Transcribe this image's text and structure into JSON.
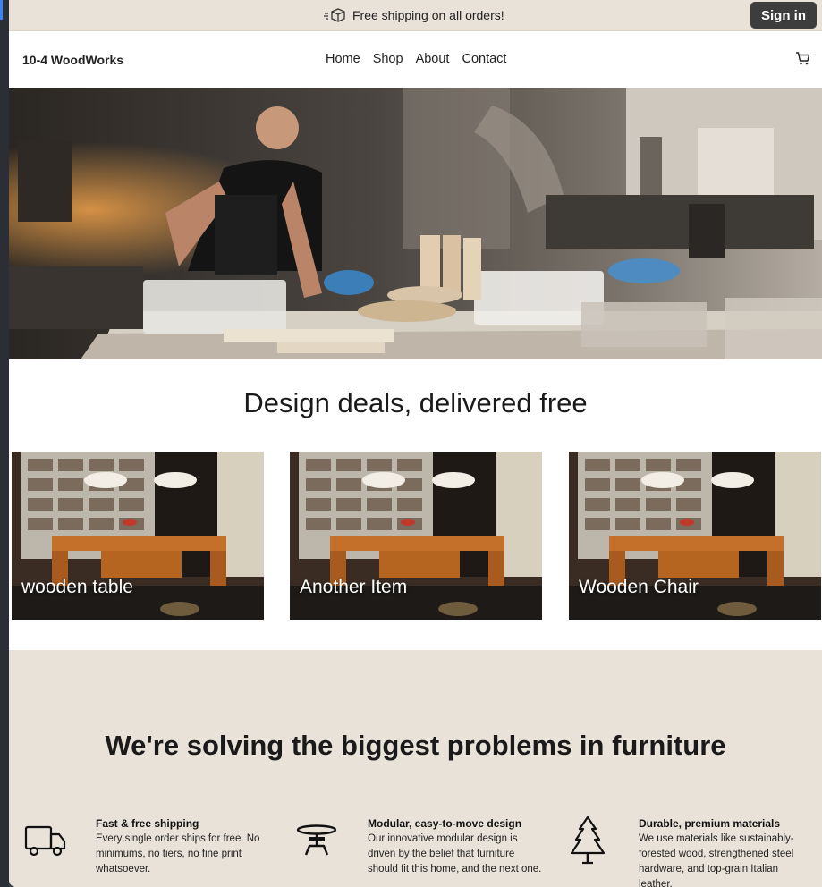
{
  "announcement": {
    "icon": "shipping-box-icon",
    "text": "Free shipping on all orders!"
  },
  "header": {
    "signin_label": "Sign in",
    "logo": "10-4 WoodWorks",
    "nav": [
      "Home",
      "Shop",
      "About",
      "Contact"
    ],
    "cart_icon": "cart-icon"
  },
  "deals": {
    "title": "Design deals, delivered free",
    "products": [
      {
        "name": "wooden table"
      },
      {
        "name": "Another Item"
      },
      {
        "name": "Wooden Chair"
      }
    ]
  },
  "problems": {
    "title": "We're solving the biggest problems in furniture",
    "features": [
      {
        "icon": "delivery-truck-icon",
        "title": "Fast & free shipping",
        "text": "Every single order ships for free. No minimums, no tiers, no fine print whatsoever."
      },
      {
        "icon": "modular-table-icon",
        "title": "Modular, easy-to-move design",
        "text": "Our innovative modular design is driven by the belief that furniture should fit this home, and the next one."
      },
      {
        "icon": "pine-tree-icon",
        "title": "Durable, premium materials",
        "text": "We use materials like sustainably-forested wood, strengthened steel hardware, and top-grain Italian leather."
      }
    ]
  },
  "colors": {
    "announce_bg": "#e8e2d8",
    "signin_bg": "#3d3d3d",
    "section_bg": "#e8e2d8"
  }
}
